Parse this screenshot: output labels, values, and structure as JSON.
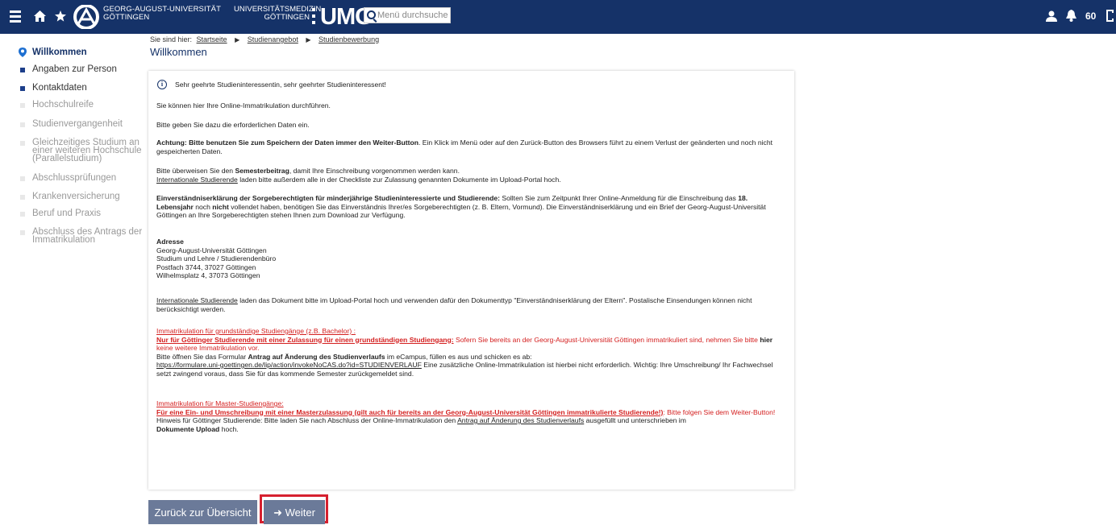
{
  "header": {
    "logo_line1": "GEORG-AUGUST-UNIVERSITÄT",
    "logo_line2": "GÖTTINGEN",
    "umg_line1": "UNIVERSITÄTSMEDIZIN",
    "umg_line2": "GÖTTINGEN",
    "umg_label": "UMG",
    "search_placeholder": "Menü durchsuche",
    "notification_count": "60",
    "icons": [
      "menu-icon",
      "home-icon",
      "star-icon",
      "search-icon",
      "user-icon",
      "bell-icon",
      "logout-icon"
    ]
  },
  "breadcrumb": {
    "prefix": "Sie sind hier:",
    "items": [
      "Startseite",
      "Studienangebot",
      "Studienbewerbung"
    ]
  },
  "page_title": "Willkommen",
  "sidebar": {
    "items": [
      {
        "label": "Willkommen",
        "state": "active"
      },
      {
        "label": "Angaben zur Person",
        "state": "done"
      },
      {
        "label": "Kontaktdaten",
        "state": "done"
      },
      {
        "label": "Hochschulreife",
        "state": "todo"
      },
      {
        "label": "Studienvergangenheit",
        "state": "todo"
      },
      {
        "label": "Gleichzeitiges Studium an einer weiteren Hochschule (Parallelstudium)",
        "state": "todo"
      },
      {
        "label": "Abschlussprüfungen",
        "state": "todo"
      },
      {
        "label": "Krankenversicherung",
        "state": "todo"
      },
      {
        "label": "Beruf und Praxis",
        "state": "todo"
      },
      {
        "label": "Abschluss des Antrags der Immatrikulation",
        "state": "todo"
      }
    ]
  },
  "content": {
    "greeting": "Sehr geehrte Studieninteressentin, sehr geehrter Studieninteressent!",
    "p1": "Sie können hier Ihre Online-Immatrikulation durchführen.",
    "p2": "Bitte geben Sie dazu die erforderlichen Daten ein.",
    "p3_bold": "Achtung: Bitte benutzen Sie zum Speichern der Daten immer den Weiter-Button",
    "p3_rest": ". Ein Klick im Menü oder auf den Zurück-Button des Browsers führt zu einem Verlust der geänderten und noch nicht gespeicherten Daten.",
    "p4_a": "Bitte überweisen Sie den ",
    "p4_bold": "Semesterbeitrag",
    "p4_b": ", damit Ihre Einschreibung vorgenommen werden kann.",
    "p4_link": "Internationale Studierende",
    "p4_c": " laden bitte außerdem alle in der Checkliste zur Zulassung genannten Dokumente im Upload-Portal hoch.",
    "p5_bold": "Einverständniserklärung der Sorgeberechtigten für minderjährige Studieninteressierte und Studierende:",
    "p5_a": " Sollten Sie zum Zeitpunkt Ihrer Online-Anmeldung für die Einschreibung das ",
    "p5_bold2": "18. Lebensjahr",
    "p5_b": " noch ",
    "p5_bold3": "nicht",
    "p5_c": " vollendet haben, benötigen Sie das Einverständnis Ihrer/es Sorgeberechtigten (z. B. Eltern, Vormund). Die Einverständniserklärung und ein Brief der Georg-August-Universität Göttingen an Ihre Sorgeberechtigten stehen Ihnen zum Download zur Verfügung.",
    "address_title": "Adresse",
    "address_lines": [
      "Georg-August-Universität Göttingen",
      "Studium und Lehre / Studierendenbüro",
      "Postfach 3744, 37027 Göttingen",
      "Wilhelmsplatz 4, 37073 Göttingen"
    ],
    "p6_link": "Internationale Studierende",
    "p6_rest": " laden das Dokument bitte im Upload-Portal hoch und verwenden dafür den Dokumenttyp \"Einverständniserklärung der Eltern\". Postalische Einsendungen können nicht berücksichtigt werden.",
    "bachelor_heading": "Immatrikulation für grundständige Studiengänge (z.B. Bachelor) :",
    "bachelor_bold": "Nur für Göttinger Studierende mit einer Zulassung für einen grundständigen Studiengang:",
    "bachelor_a": " Sofern Sie bereits an der Georg-August-Universität Göttingen immatrikuliert sind, nehmen Sie bitte ",
    "bachelor_bold2": "hier",
    "bachelor_b": " keine weitere Immatrikulation vor.",
    "form_a": "Bitte öffnen Sie das Formular ",
    "form_bold": "Antrag auf Änderung des Studienverlaufs",
    "form_b": " im eCampus, füllen es aus und schicken es ab:",
    "form_url": "https://formulare.uni-goettingen.de/lip/action/invokeNoCAS.do?id=STUDIENVERLAUF",
    "form_c": " Eine zusätzliche Online-Immatrikulation ist hierbei nicht erforderlich. Wichtig: Ihre Umschreibung/ Ihr Fachwechsel setzt zwingend voraus, dass Sie für das kommende Semester zurückgemeldet sind.",
    "master_heading": "Immatrikulation für Master-Studiengänge:",
    "master_bold": "Für eine Ein- und Umschreibung mit einer Masterzulassung (gilt auch für bereits an der Georg-August-Universität Göttingen immatrikulierte Studierende!)",
    "master_rest": ": Bitte folgen Sie dem Weiter-Button!",
    "hint_a": "Hinweis für Göttinger Studierende: Bitte laden Sie nach Abschluss der Online-Immatrikulation den ",
    "hint_link": "Antrag auf Änderung des Studienverlaufs",
    "hint_b": " ausgefüllt und unterschrieben im ",
    "hint_bold": "Dokumente Upload",
    "hint_c": " hoch."
  },
  "buttons": {
    "back": "Zurück zur Übersicht",
    "next": "Weiter",
    "next_icon": "arrow-right-icon"
  },
  "colors": {
    "header_bg": "#153268",
    "button_bg": "#6b7a99",
    "warning_red": "#d42020",
    "highlight_border": "#d6202f"
  }
}
